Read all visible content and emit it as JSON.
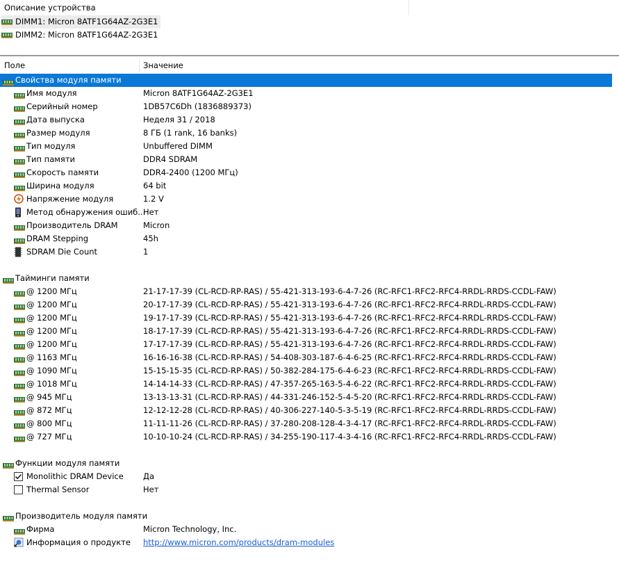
{
  "device_pane": {
    "header": "Описание устройства",
    "items": [
      {
        "label": "DIMM1: Micron 8ATF1G64AZ-2G3E1",
        "selected": true
      },
      {
        "label": "DIMM2: Micron 8ATF1G64AZ-2G3E1",
        "selected": false
      }
    ]
  },
  "columns": {
    "field": "Поле",
    "value": "Значение"
  },
  "colors": {
    "selection": "#0a78d7",
    "link": "#1a5cd6",
    "ram_icon": "#2e6b34"
  },
  "rows": [
    {
      "kind": "group",
      "icon": "ram-icon",
      "field": "Свойства модуля памяти",
      "value": "",
      "selected": true
    },
    {
      "kind": "item",
      "icon": "ram-icon",
      "field": "Имя модуля",
      "value": "Micron 8ATF1G64AZ-2G3E1"
    },
    {
      "kind": "item",
      "icon": "ram-icon",
      "field": "Серийный номер",
      "value": "1DB57C6Dh (1836889373)"
    },
    {
      "kind": "item",
      "icon": "ram-icon",
      "field": "Дата выпуска",
      "value": "Неделя 31 / 2018"
    },
    {
      "kind": "item",
      "icon": "ram-icon",
      "field": "Размер модуля",
      "value": "8 ГБ (1 rank, 16 banks)"
    },
    {
      "kind": "item",
      "icon": "ram-icon",
      "field": "Тип модуля",
      "value": "Unbuffered DIMM"
    },
    {
      "kind": "item",
      "icon": "ram-icon",
      "field": "Тип памяти",
      "value": "DDR4 SDRAM"
    },
    {
      "kind": "item",
      "icon": "ram-icon",
      "field": "Скорость памяти",
      "value": "DDR4-2400 (1200 МГц)"
    },
    {
      "kind": "item",
      "icon": "ram-icon",
      "field": "Ширина модуля",
      "value": "64 bit"
    },
    {
      "kind": "item",
      "icon": "voltage-icon",
      "field": "Напряжение модуля",
      "value": "1.2 V"
    },
    {
      "kind": "item",
      "icon": "device-icon",
      "field": "Метод обнаружения ошиб...",
      "value": "Нет"
    },
    {
      "kind": "item",
      "icon": "ram-icon",
      "field": "Производитель DRAM",
      "value": "Micron"
    },
    {
      "kind": "item",
      "icon": "ram-icon",
      "field": "DRAM Stepping",
      "value": "45h"
    },
    {
      "kind": "item",
      "icon": "chip-icon",
      "field": "SDRAM Die Count",
      "value": "1"
    },
    {
      "kind": "blank"
    },
    {
      "kind": "group",
      "icon": "ram-icon",
      "field": "Тайминги памяти",
      "value": ""
    },
    {
      "kind": "item",
      "icon": "ram-icon",
      "field": "@ 1200 МГц",
      "value": "21-17-17-39  (CL-RCD-RP-RAS) / 55-421-313-193-6-4-7-26  (RC-RFC1-RFC2-RFC4-RRDL-RRDS-CCDL-FAW)"
    },
    {
      "kind": "item",
      "icon": "ram-icon",
      "field": "@ 1200 МГц",
      "value": "20-17-17-39  (CL-RCD-RP-RAS) / 55-421-313-193-6-4-7-26  (RC-RFC1-RFC2-RFC4-RRDL-RRDS-CCDL-FAW)"
    },
    {
      "kind": "item",
      "icon": "ram-icon",
      "field": "@ 1200 МГц",
      "value": "19-17-17-39  (CL-RCD-RP-RAS) / 55-421-313-193-6-4-7-26  (RC-RFC1-RFC2-RFC4-RRDL-RRDS-CCDL-FAW)"
    },
    {
      "kind": "item",
      "icon": "ram-icon",
      "field": "@ 1200 МГц",
      "value": "18-17-17-39  (CL-RCD-RP-RAS) / 55-421-313-193-6-4-7-26  (RC-RFC1-RFC2-RFC4-RRDL-RRDS-CCDL-FAW)"
    },
    {
      "kind": "item",
      "icon": "ram-icon",
      "field": "@ 1200 МГц",
      "value": "17-17-17-39  (CL-RCD-RP-RAS) / 55-421-313-193-6-4-7-26  (RC-RFC1-RFC2-RFC4-RRDL-RRDS-CCDL-FAW)"
    },
    {
      "kind": "item",
      "icon": "ram-icon",
      "field": "@ 1163 МГц",
      "value": "16-16-16-38  (CL-RCD-RP-RAS) / 54-408-303-187-6-4-6-25  (RC-RFC1-RFC2-RFC4-RRDL-RRDS-CCDL-FAW)"
    },
    {
      "kind": "item",
      "icon": "ram-icon",
      "field": "@ 1090 МГц",
      "value": "15-15-15-35  (CL-RCD-RP-RAS) / 50-382-284-175-6-4-6-23  (RC-RFC1-RFC2-RFC4-RRDL-RRDS-CCDL-FAW)"
    },
    {
      "kind": "item",
      "icon": "ram-icon",
      "field": "@ 1018 МГц",
      "value": "14-14-14-33  (CL-RCD-RP-RAS) / 47-357-265-163-5-4-6-22  (RC-RFC1-RFC2-RFC4-RRDL-RRDS-CCDL-FAW)"
    },
    {
      "kind": "item",
      "icon": "ram-icon",
      "field": "@ 945 МГц",
      "value": "13-13-13-31  (CL-RCD-RP-RAS) / 44-331-246-152-5-4-5-20  (RC-RFC1-RFC2-RFC4-RRDL-RRDS-CCDL-FAW)"
    },
    {
      "kind": "item",
      "icon": "ram-icon",
      "field": "@ 872 МГц",
      "value": "12-12-12-28  (CL-RCD-RP-RAS) / 40-306-227-140-5-3-5-19  (RC-RFC1-RFC2-RFC4-RRDL-RRDS-CCDL-FAW)"
    },
    {
      "kind": "item",
      "icon": "ram-icon",
      "field": "@ 800 МГц",
      "value": "11-11-11-26  (CL-RCD-RP-RAS) / 37-280-208-128-4-3-4-17  (RC-RFC1-RFC2-RFC4-RRDL-RRDS-CCDL-FAW)"
    },
    {
      "kind": "item",
      "icon": "ram-icon",
      "field": "@ 727 МГц",
      "value": "10-10-10-24  (CL-RCD-RP-RAS) / 34-255-190-117-4-3-4-16  (RC-RFC1-RFC2-RFC4-RRDL-RRDS-CCDL-FAW)"
    },
    {
      "kind": "blank"
    },
    {
      "kind": "group",
      "icon": "ram-icon",
      "field": "Функции модуля памяти",
      "value": ""
    },
    {
      "kind": "item",
      "icon": "checkbox-checked-icon",
      "field": "Monolithic DRAM Device",
      "value": "Да"
    },
    {
      "kind": "item",
      "icon": "checkbox-unchecked-icon",
      "field": "Thermal Sensor",
      "value": "Нет"
    },
    {
      "kind": "blank"
    },
    {
      "kind": "group",
      "icon": "ram-icon",
      "field": "Производитель модуля памяти",
      "value": ""
    },
    {
      "kind": "item",
      "icon": "ram-icon",
      "field": "Фирма",
      "value": "Micron Technology, Inc."
    },
    {
      "kind": "item",
      "icon": "web-link-icon",
      "field": "Информация о продукте",
      "value": "http://www.micron.com/products/dram-modules",
      "link": true
    }
  ]
}
